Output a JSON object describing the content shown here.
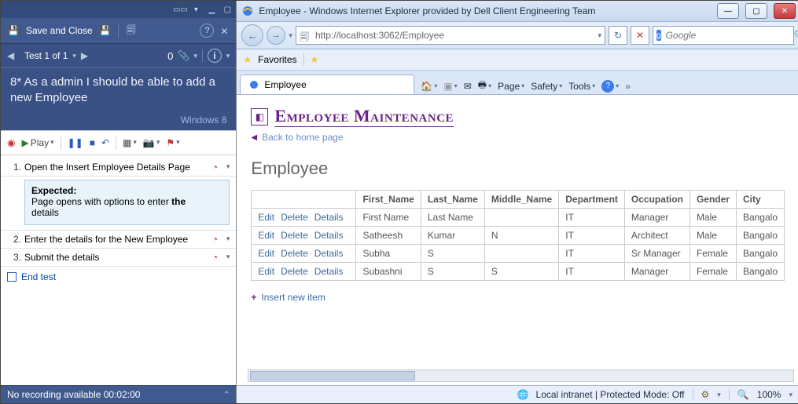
{
  "left": {
    "toolbar": {
      "save_close": "Save and Close"
    },
    "nav": {
      "test_of": "Test 1 of 1",
      "zero": "0"
    },
    "title": "8* As a admin I should be able to add a new Employee",
    "platform": "Windows 8",
    "runner_tb": {
      "play": "Play"
    },
    "steps": [
      {
        "n": "1.",
        "text": "Open the Insert Employee Details Page",
        "expected_title": "Expected:",
        "expected_body_1": "Page opens with options to enter ",
        "expected_body_bold": "the",
        "expected_body_2": "details"
      },
      {
        "n": "2.",
        "text": "Enter the details for the New Employee"
      },
      {
        "n": "3.",
        "text": "Submit the details"
      }
    ],
    "end_test": "End test",
    "status": "No recording available 00:02:00"
  },
  "ie": {
    "window_title": "Employee - Windows Internet Explorer provided by Dell Client Engineering Team",
    "url": "http://localhost:3062/Employee",
    "search_engine": "Google",
    "favorites": "Favorites",
    "tab_label": "Employee",
    "menu": {
      "page": "Page",
      "safety": "Safety",
      "tools": "Tools"
    },
    "page": {
      "heading": "Employee Maintenance",
      "back": "Back to home page",
      "subheading": "Employee",
      "insert": "Insert new item",
      "action_edit": "Edit",
      "action_delete": "Delete",
      "action_details": "Details",
      "columns": [
        "First_Name",
        "Last_Name",
        "Middle_Name",
        "Department",
        "Occupation",
        "Gender",
        "City"
      ],
      "rows": [
        {
          "first": "First Name",
          "last": "Last Name",
          "mid": "",
          "dept": "IT",
          "occ": "Manager",
          "gender": "Male",
          "city": "Bangalo"
        },
        {
          "first": "Satheesh",
          "last": "Kumar",
          "mid": "N",
          "dept": "IT",
          "occ": "Architect",
          "gender": "Male",
          "city": "Bangalo"
        },
        {
          "first": "Subha",
          "last": "S",
          "mid": "",
          "dept": "IT",
          "occ": "Sr Manager",
          "gender": "Female",
          "city": "Bangalo"
        },
        {
          "first": "Subashni",
          "last": "S",
          "mid": "S",
          "dept": "IT",
          "occ": "Manager",
          "gender": "Female",
          "city": "Bangalo"
        }
      ]
    },
    "status": {
      "zone": "Local intranet | Protected Mode: Off",
      "zoom": "100%"
    }
  }
}
